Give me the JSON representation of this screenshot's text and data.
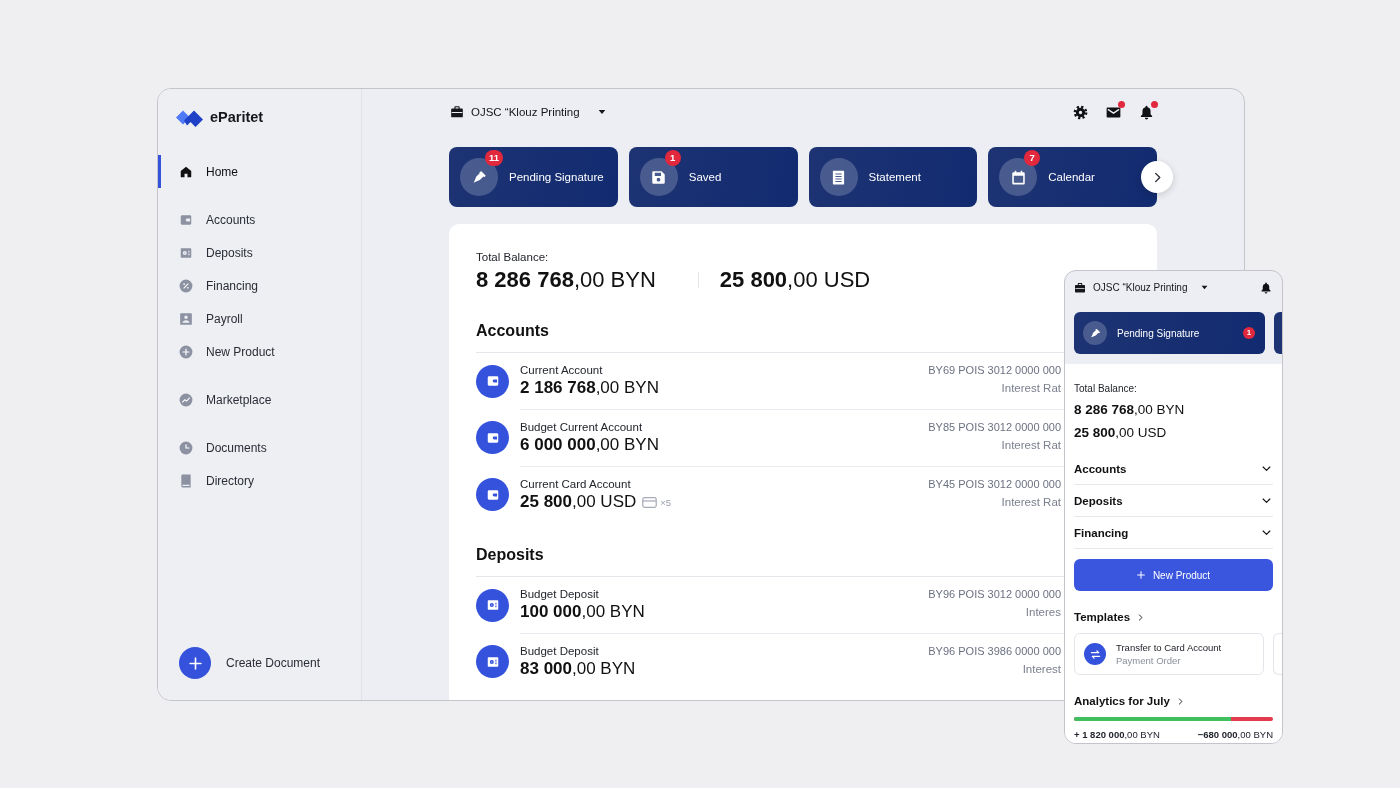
{
  "app": {
    "name": "eParitet"
  },
  "sidebar": {
    "groups": [
      {
        "items": [
          {
            "label": "Home",
            "selected": true
          }
        ]
      },
      {
        "items": [
          {
            "label": "Accounts",
            "selected": false
          },
          {
            "label": "Deposits",
            "selected": false
          },
          {
            "label": "Financing",
            "selected": false
          },
          {
            "label": "Payroll",
            "selected": false
          },
          {
            "label": "New Product",
            "selected": false
          }
        ]
      },
      {
        "items": [
          {
            "label": "Marketplace",
            "selected": false
          }
        ]
      },
      {
        "items": [
          {
            "label": "Documents",
            "selected": false
          },
          {
            "label": "Directory",
            "selected": false
          }
        ]
      }
    ],
    "create_button": {
      "label": "Create Document"
    }
  },
  "header": {
    "company": "OJSC “Klouz Printing",
    "icons": [
      {
        "kind": "settings",
        "dot": false
      },
      {
        "kind": "mail",
        "dot": true
      },
      {
        "kind": "bell",
        "dot": true
      }
    ]
  },
  "quick_actions": [
    {
      "kind": "signature",
      "label": "Pending Signature",
      "badge": "11"
    },
    {
      "kind": "saved",
      "label": "Saved",
      "badge": "1"
    },
    {
      "kind": "statement",
      "label": "Statement"
    },
    {
      "kind": "calendar",
      "label": "Calendar",
      "badge": "7"
    }
  ],
  "balance": {
    "label": "Total Balance:",
    "amounts": [
      "**8 286 768**,00 BYN",
      "**25 800**,00 USD"
    ]
  },
  "sections": [
    {
      "title": "Accounts",
      "rows": [
        {
          "kind": "account",
          "name": "Current Account",
          "amount": "**2 186 768**,00 BYN",
          "iban": "BY69 POIS 3012 0000 000",
          "detail": "Interest Rat"
        },
        {
          "kind": "account",
          "name": "Budget Current Account",
          "amount": "**6 000 000**,00 BYN",
          "iban": "BY85 POIS 3012 0000 000",
          "detail": "Interest Rat"
        },
        {
          "kind": "account",
          "name": "Current Card Account",
          "amount": "**25 800**,00 USD",
          "cards": "×5",
          "iban": "BY45 POIS 3012 0000 000",
          "detail": "Interest Rat"
        }
      ]
    },
    {
      "title": "Deposits",
      "rows": [
        {
          "kind": "deposit",
          "name": "Budget Deposit",
          "amount": "**100 000**,00 BYN",
          "iban": "BY96 POIS 3012 0000 000",
          "detail": "Interes"
        },
        {
          "kind": "deposit",
          "name": "Budget Deposit",
          "amount": "**83 000**,00 BYN",
          "iban": "BY96 POIS 3986 0000 000",
          "detail": "Interest"
        }
      ]
    }
  ],
  "mobile": {
    "header": {
      "company": "OJSC “Klouz Printing",
      "icons": [
        {
          "kind": "bell",
          "dot": false
        }
      ]
    },
    "quick_actions": [
      {
        "kind": "signature",
        "label": "Pending Signature",
        "badge": "1"
      }
    ],
    "balance": {
      "label": "Total Balance:",
      "amounts": [
        "**8 286 768**,00 BYN",
        "**25 800**,00 USD"
      ]
    },
    "sections": [
      {
        "label": "Accounts",
        "expanded": false
      },
      {
        "label": "Deposits",
        "expanded": false
      },
      {
        "label": "Financing",
        "expanded": false
      }
    ],
    "new_product_button": {
      "label": "New Product"
    },
    "templates": {
      "title": "Templates",
      "items": [
        {
          "name": "Transfer to Card Account",
          "type": "Payment Order"
        }
      ]
    },
    "analytics": {
      "title": "Analytics for July",
      "level": 0.79,
      "income": "**+ 1 820 000**,00 BYN",
      "expense": "**−680 000**,00 BYN"
    }
  }
}
